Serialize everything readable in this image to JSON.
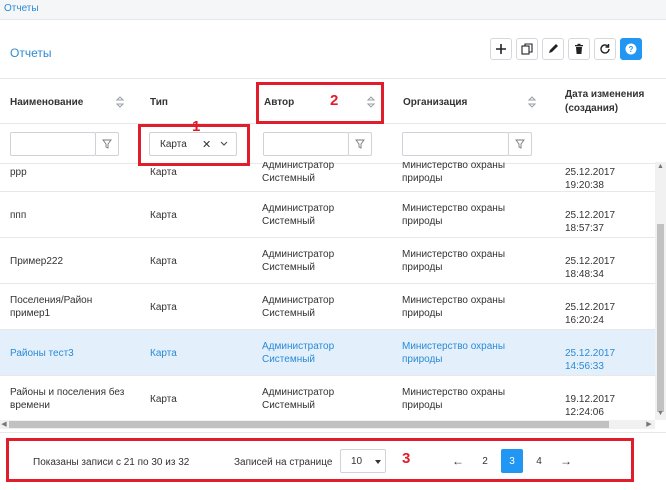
{
  "breadcrumb": {
    "label": "Отчеты"
  },
  "panel": {
    "title": "Отчеты"
  },
  "toolbar": {
    "buttons": [
      {
        "name": "add-button",
        "icon": "plus-icon"
      },
      {
        "name": "copy-button",
        "icon": "copy-icon"
      },
      {
        "name": "edit-button",
        "icon": "pencil-icon"
      },
      {
        "name": "delete-button",
        "icon": "trash-icon"
      },
      {
        "name": "refresh-button",
        "icon": "refresh-icon"
      },
      {
        "name": "help-button",
        "icon": "question-icon"
      }
    ],
    "accent_color": "#2196f3"
  },
  "table": {
    "columns": {
      "name": "Наименование",
      "type": "Тип",
      "author": "Автор",
      "organization": "Организация",
      "date_line1": "Дата изменения",
      "date_line2": "(создания)"
    },
    "filters": {
      "name_value": "",
      "type_value": "Карта",
      "author_value": "",
      "organization_value": ""
    },
    "rows": [
      {
        "name1": "ррр",
        "name2": "",
        "type": "Карта",
        "author1": "Администратор",
        "author2": "Системный",
        "org1": "Министерство охраны",
        "org2": "природы",
        "date": "25.12.2017 19:20:38"
      },
      {
        "name1": "ппп",
        "name2": "",
        "type": "Карта",
        "author1": "Администратор",
        "author2": "Системный",
        "org1": "Министерство охраны",
        "org2": "природы",
        "date": "25.12.2017 18:57:37"
      },
      {
        "name1": "Пример222",
        "name2": "",
        "type": "Карта",
        "author1": "Администратор",
        "author2": "Системный",
        "org1": "Министерство охраны",
        "org2": "природы",
        "date": "25.12.2017 18:48:34"
      },
      {
        "name1": "Поселения/Район",
        "name2": "пример1",
        "type": "Карта",
        "author1": "Администратор",
        "author2": "Системный",
        "org1": "Министерство охраны",
        "org2": "природы",
        "date": "25.12.2017 16:20:24"
      },
      {
        "name1": "Районы тест3",
        "name2": "",
        "type": "Карта",
        "author1": "Администратор",
        "author2": "Системный",
        "org1": "Министерство охраны",
        "org2": "природы",
        "date": "25.12.2017 14:56:33",
        "selected": true
      },
      {
        "name1": "Районы и поселения без",
        "name2": "времени",
        "type": "Карта",
        "author1": "Администратор",
        "author2": "Системный",
        "org1": "Министерство охраны",
        "org2": "природы",
        "date": "19.12.2017 12:24:06"
      }
    ],
    "selected_row_color": "#e3f0fb"
  },
  "footer": {
    "records_info": "Показаны записи с 21 по 30 из 32",
    "per_page_label": "Записей на странице",
    "per_page_value": "10",
    "pages": [
      "2",
      "3",
      "4"
    ],
    "current_page": "3",
    "prev": "←",
    "next": "→"
  },
  "annotations": {
    "color": "#e01e2b",
    "labels": [
      "1",
      "2",
      "3"
    ]
  }
}
